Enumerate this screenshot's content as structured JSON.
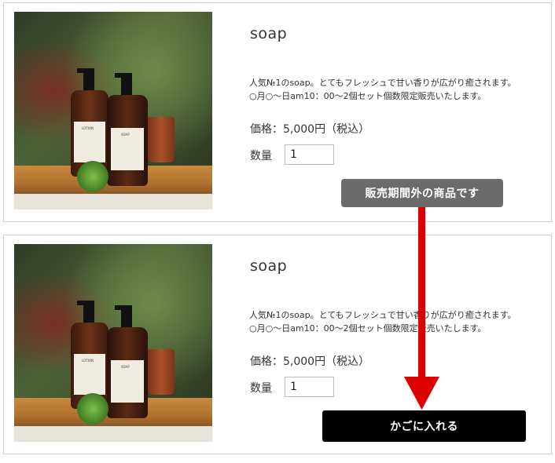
{
  "top_card": {
    "title": "soap",
    "desc_line1": "人気№1のsoap。とてもフレッシュで甘い香りが広がり癒されます。",
    "desc_line2": "○月○～日am10：00～2個セット個数限定販売いたします。",
    "price": "価格：5,000円（税込）",
    "qty_label": "数量",
    "qty_value": "1",
    "status_label": "販売期間外の商品です"
  },
  "bottom_card": {
    "title": "soap",
    "desc_line1": "人気№1のsoap。とてもフレッシュで甘い香りが広がり癒されます。",
    "desc_line2": "○月○～日am10：00～2個セット個数限定販売いたします。",
    "price": "価格：5,000円（税込）",
    "qty_label": "数量",
    "qty_value": "1",
    "cart_label": "かごに入れる"
  },
  "product_photo": {
    "bottle1_label": "LOTION",
    "bottle2_label": "SOAP"
  },
  "colors": {
    "arrow": "#dd0000",
    "unavailable_bg": "#6b6b6b",
    "cart_bg": "#000000"
  }
}
